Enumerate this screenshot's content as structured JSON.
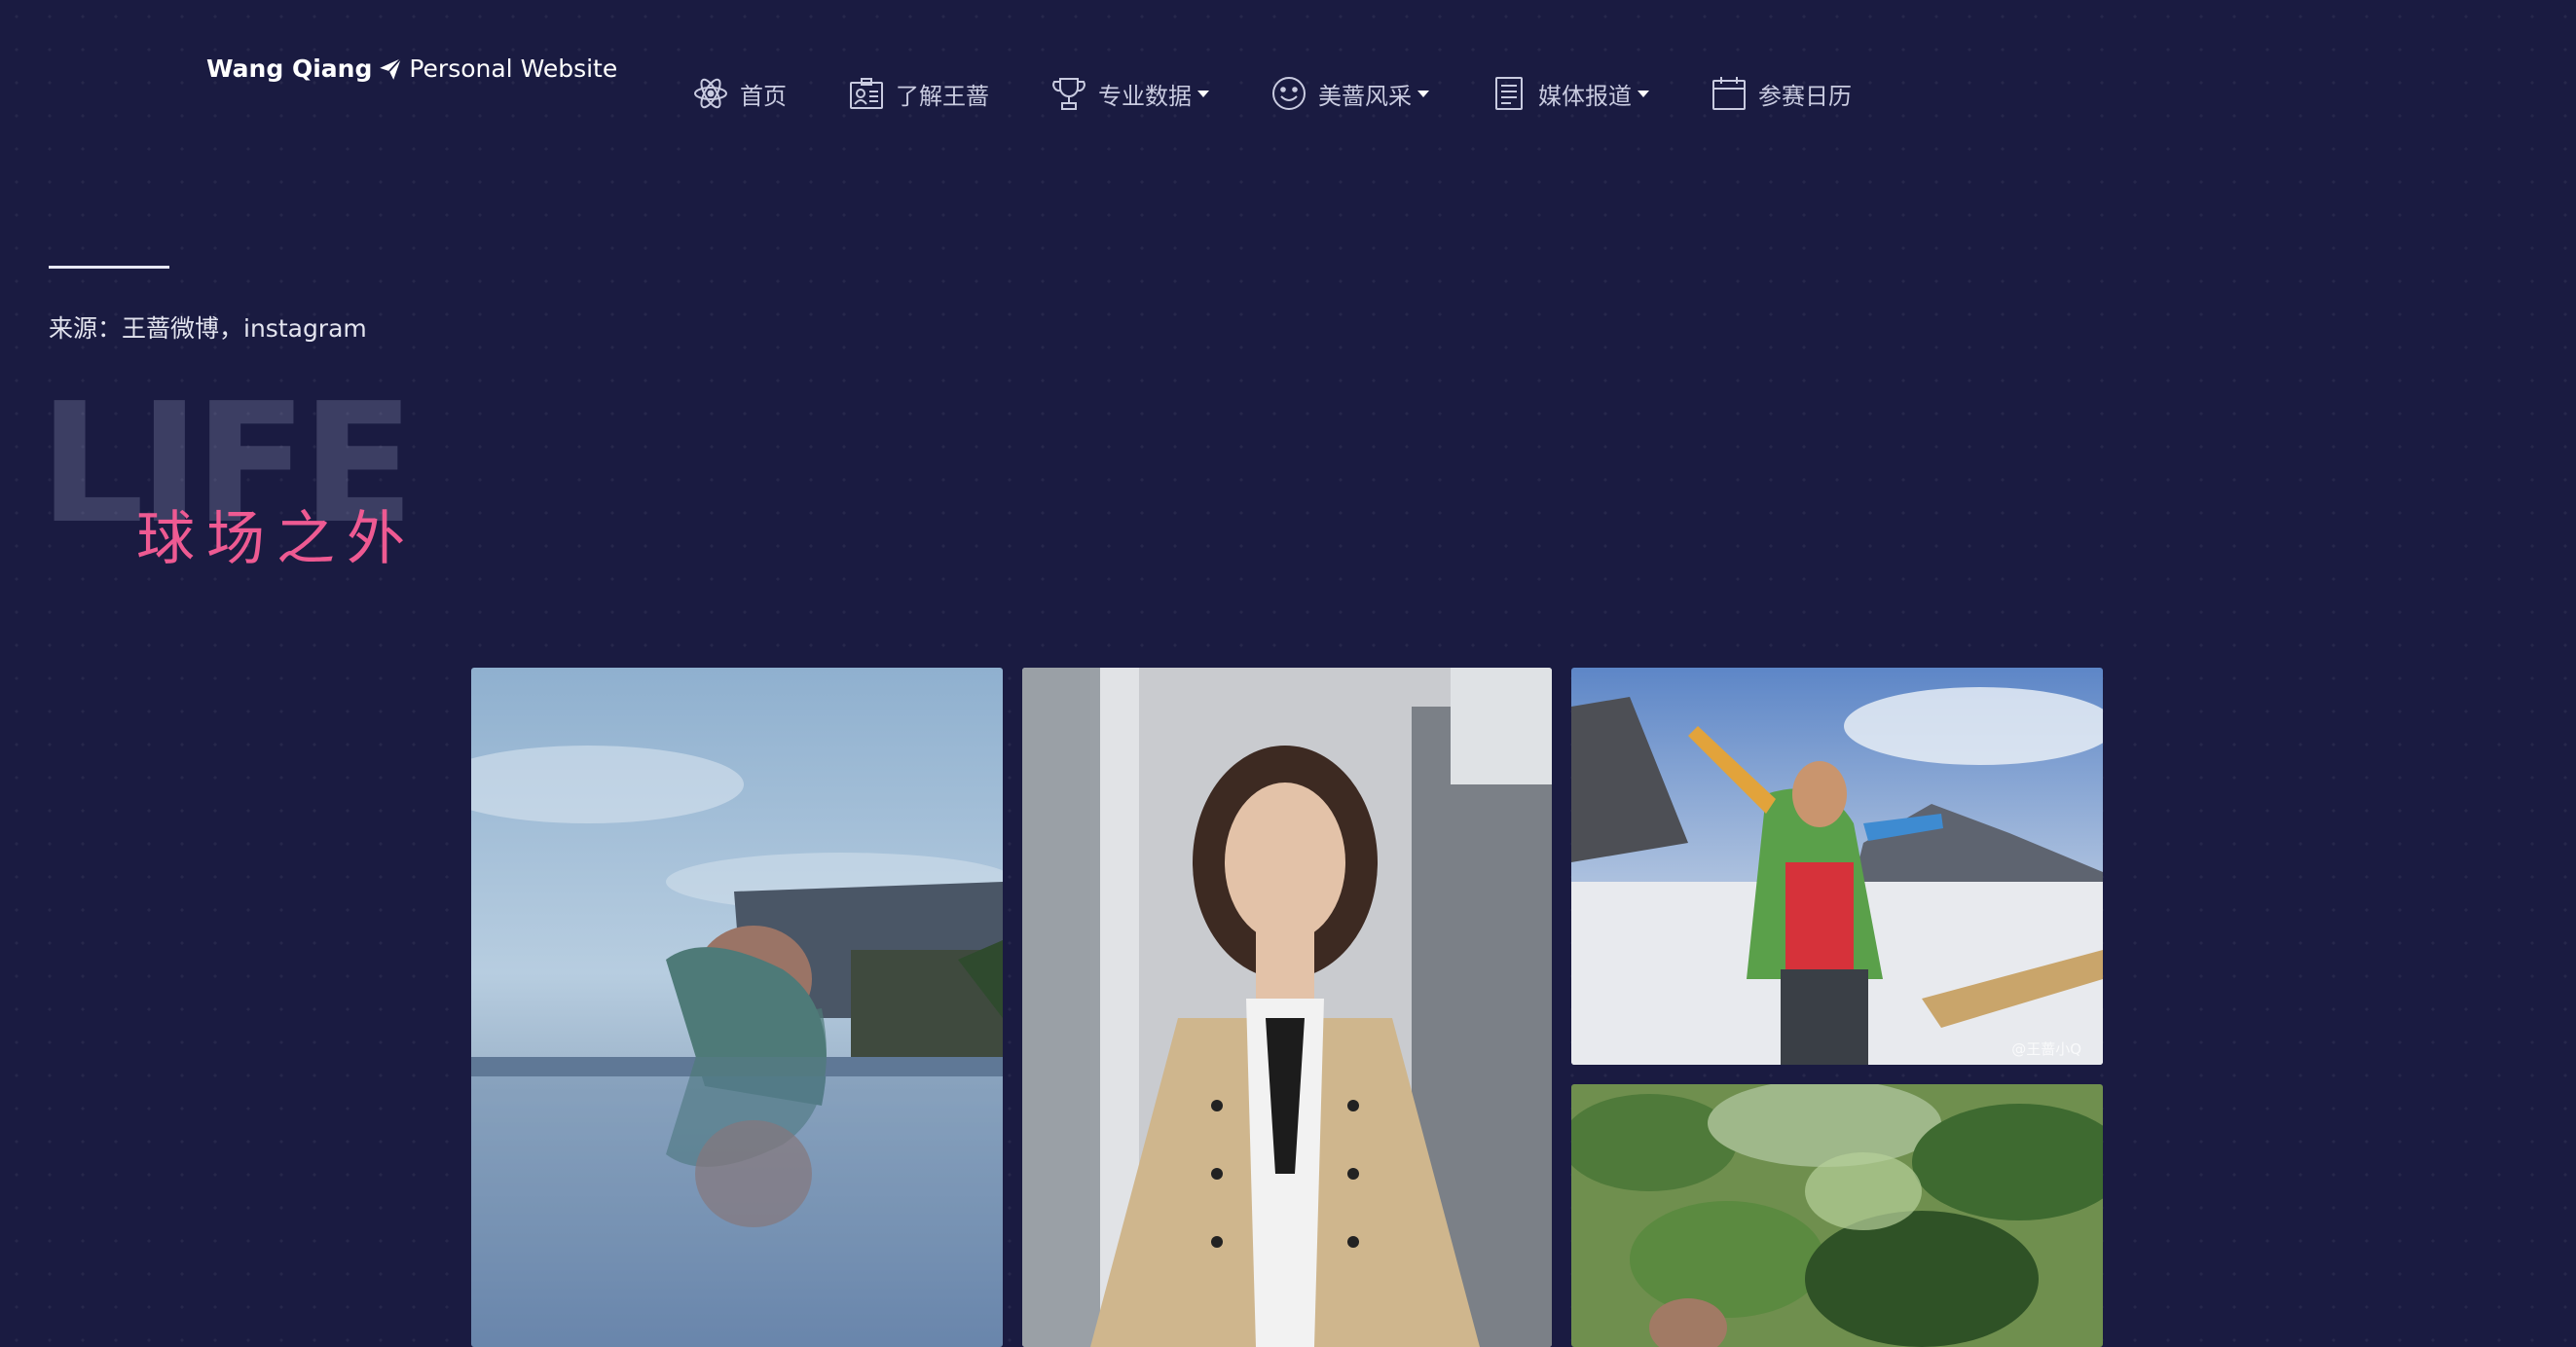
{
  "header": {
    "brand_name": "Wang Qiang",
    "brand_sub": "Personal Website",
    "nav": [
      {
        "label": "首页",
        "icon": "atom-icon",
        "dropdown": false
      },
      {
        "label": "了解王蔷",
        "icon": "id-card-icon",
        "dropdown": false
      },
      {
        "label": "专业数据",
        "icon": "trophy-icon",
        "dropdown": true
      },
      {
        "label": "美蔷风采",
        "icon": "smile-icon",
        "dropdown": true
      },
      {
        "label": "媒体报道",
        "icon": "document-icon",
        "dropdown": true
      },
      {
        "label": "参赛日历",
        "icon": "calendar-icon",
        "dropdown": false
      }
    ]
  },
  "section": {
    "source": "来源：王蔷微博，instagram",
    "bg_word": "LIFE",
    "title": "球场之外"
  },
  "gallery": {
    "watermark": "@王蔷小Q"
  },
  "colors": {
    "background": "#1a1b41",
    "accent": "#ee5a92",
    "nav_text": "#c9cbe0"
  }
}
